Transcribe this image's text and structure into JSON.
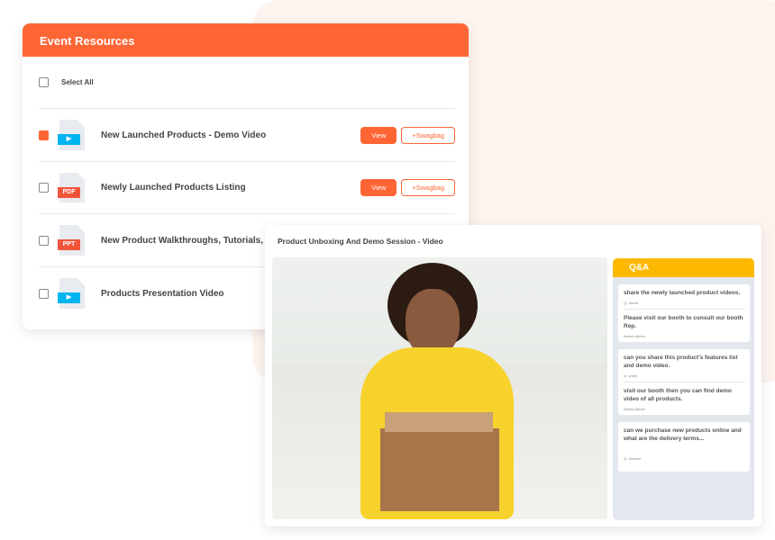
{
  "resources": {
    "title": "Event Resources",
    "select_all": "Select All",
    "items": [
      {
        "title": "New Launched Products - Demo Video",
        "type": "video",
        "checked": true,
        "view": "View",
        "swag": "+Swagbag"
      },
      {
        "title": "Newly Launched Products Listing",
        "type": "PDF",
        "checked": false,
        "view": "View",
        "swag": "+Swagbag"
      },
      {
        "title": "New Product Walkthroughs, Tutorials, Te",
        "type": "PPT",
        "checked": false
      },
      {
        "title": "Products Presentation Video",
        "type": "video",
        "checked": false
      }
    ]
  },
  "video": {
    "title": "Product Unboxing And Demo Session - Video"
  },
  "qa": {
    "title": "Q&A",
    "groups": [
      [
        {
          "text": "share the newly launched product videos.",
          "by": "Q: Jacob"
        },
        {
          "text": "Please visit our booth to consult our booth Rep.",
          "by": "Admin:Admin"
        }
      ],
      [
        {
          "text": "can you share this product's features list and demo video.",
          "by": "Q: smith"
        },
        {
          "text": "visit our booth then you can find demo video of all products.",
          "by": "Admin:Admin"
        }
      ],
      [
        {
          "text": "can we purchase new products online and what are the delivery terms...",
          "by": "Q: Smauel"
        }
      ]
    ]
  },
  "colors": {
    "accent": "#fe6535",
    "qa": "#fdb900",
    "video_icon": "#00b4f0",
    "pdf": "#f0543a"
  }
}
